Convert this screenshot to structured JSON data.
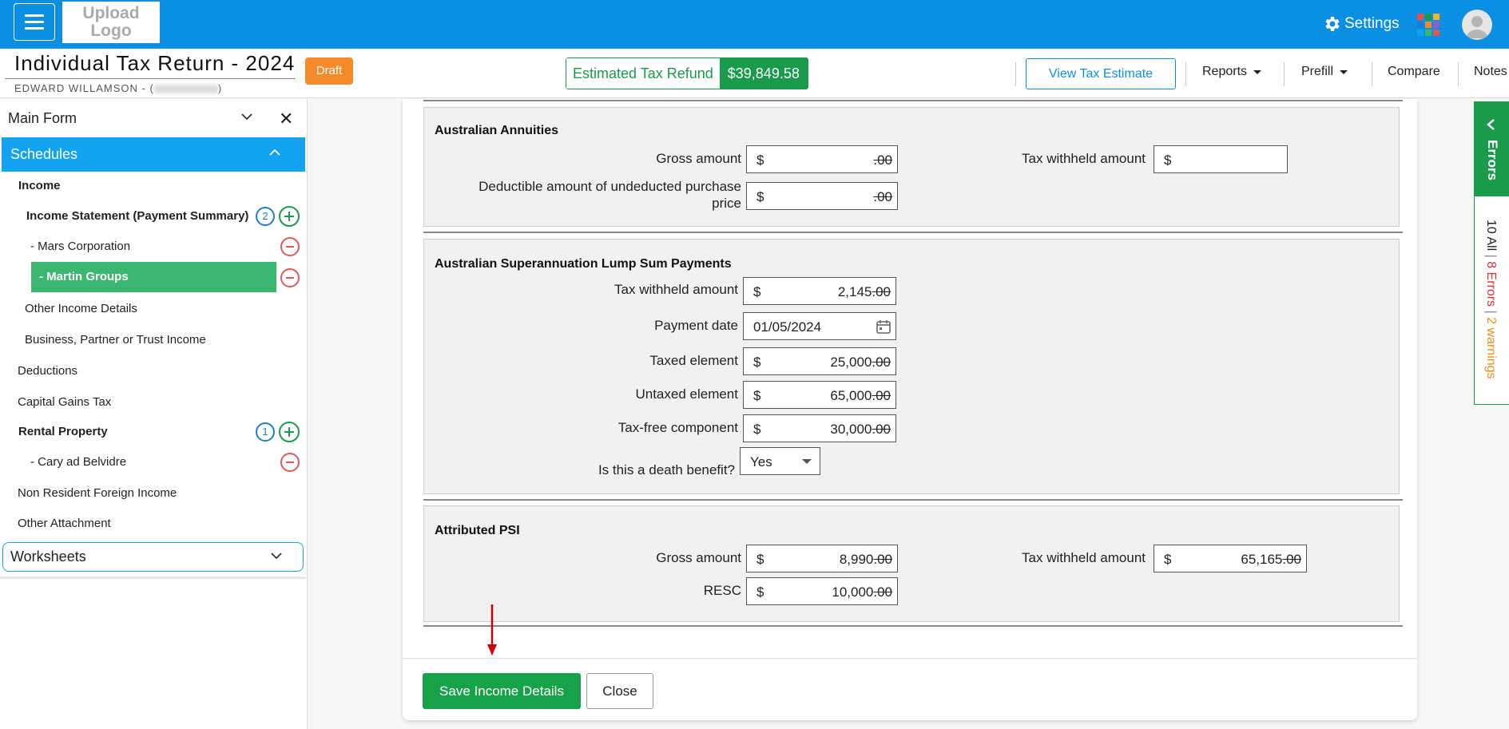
{
  "topbar": {
    "logo_line1": "Upload",
    "logo_line2": "Logo",
    "settings_label": "Settings",
    "accent_color": "#0b8fe2",
    "apps_colors": [
      "#e8504b",
      "#1a9a4b",
      "#f5b52a",
      "#1d7dd4",
      "#f58a2b",
      "#8a60c8",
      "#14a3f0",
      "#3bb771",
      "#e05858"
    ]
  },
  "header": {
    "title": "Individual Tax Return - 2024",
    "client_name": "EDWARD WILLAMSON - (",
    "client_suffix": ")",
    "status_badge": "Draft",
    "refund_label": "Estimated Tax Refund",
    "refund_value": "$39,849.58",
    "view_estimate": "View Tax Estimate",
    "reports": "Reports",
    "prefill": "Prefill",
    "compare": "Compare",
    "notes": "Notes"
  },
  "sidebar": {
    "main_form": "Main Form",
    "schedules": "Schedules",
    "income": "Income",
    "income_statement": "Income Statement (Payment Summary)",
    "income_statement_count": "2",
    "mars": "-  Mars Corporation",
    "martin": "-  Martin Groups",
    "other_income": "Other Income Details",
    "business": "Business, Partner or Trust Income",
    "deductions": "Deductions",
    "cgt": "Capital Gains Tax",
    "rental": "Rental Property",
    "rental_count": "1",
    "cary": "- Cary ad Belvidre",
    "non_resident": "Non Resident Foreign Income",
    "other_attachment": "Other Attachment",
    "worksheets": "Worksheets"
  },
  "annuities": {
    "title": "Australian Annuities",
    "gross_label": "Gross amount",
    "gross_value": ".00",
    "tax_withheld_label": "Tax withheld amount",
    "tax_withheld_value": "",
    "deductible_label_1": "Deductible amount of undeducted purchase",
    "deductible_label_2": "price",
    "deductible_value": ".00"
  },
  "super": {
    "title": "Australian Superannuation Lump Sum Payments",
    "tax_withheld_label": "Tax withheld amount",
    "tax_withheld_int": "2,145",
    "payment_date_label": "Payment date",
    "payment_date": "01/05/2024",
    "taxed_label": "Taxed element",
    "taxed_int": "25,000",
    "untaxed_label": "Untaxed element",
    "untaxed_int": "65,000",
    "taxfree_label": "Tax-free component",
    "taxfree_int": "30,000",
    "death_label": "Is this a death benefit?",
    "death_value": "Yes"
  },
  "psi": {
    "title": "Attributed PSI",
    "gross_label": "Gross amount",
    "gross_int": "8,990",
    "tax_withheld_label": "Tax withheld amount",
    "tax_withheld_int": "65,165",
    "resc_label": "RESC",
    "resc_int": "10,000"
  },
  "common": {
    "dollar": "$",
    "decimals": ".00"
  },
  "footer": {
    "save": "Save Income Details",
    "close": "Close"
  },
  "errors_panel": {
    "title": "Errors",
    "all": "10 All",
    "errors": "8 Errors",
    "warnings": "2 warnings",
    "sep": "|"
  }
}
